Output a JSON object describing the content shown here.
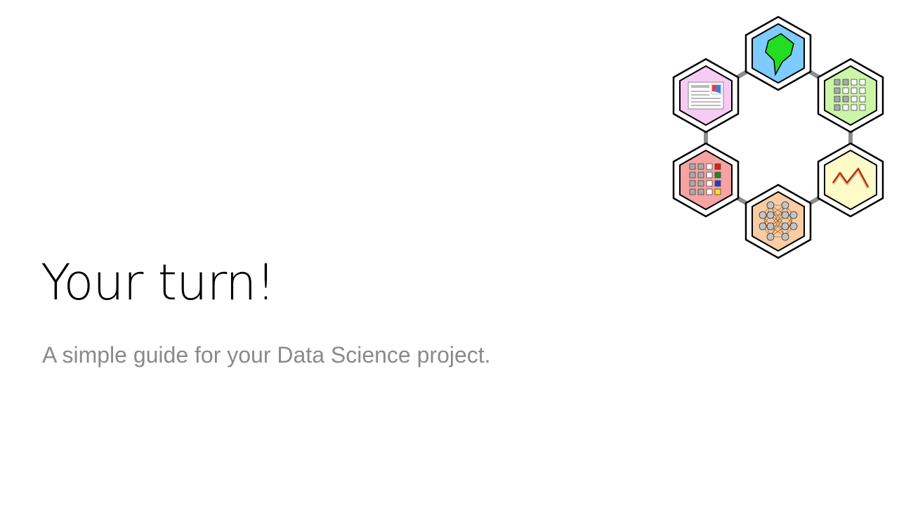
{
  "slide": {
    "title": "Your turn!",
    "subtitle": "A simple guide for your Data Science project."
  },
  "diagram": {
    "hexagons": [
      {
        "name": "map-icon",
        "fill": "#7ecbff"
      },
      {
        "name": "data-grid-icon",
        "fill": "#ccf5a8"
      },
      {
        "name": "line-chart-icon",
        "fill": "#fdfcc8"
      },
      {
        "name": "neural-network-icon",
        "fill": "#f8cda4"
      },
      {
        "name": "colored-grid-icon",
        "fill": "#f7a3a3"
      },
      {
        "name": "report-document-icon",
        "fill": "#f7cbf5"
      }
    ],
    "connector_color": "#8c8c8c"
  }
}
